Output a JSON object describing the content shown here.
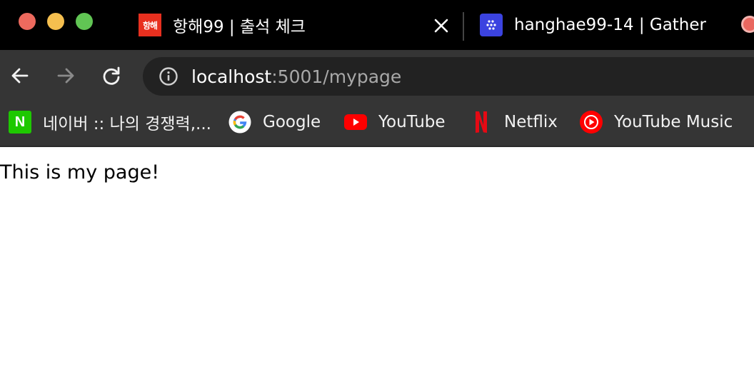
{
  "window": {
    "controls": {
      "close_color": "#ed6a5e",
      "minimize_color": "#f5bf4f",
      "maximize_color": "#61c554"
    }
  },
  "tabs": [
    {
      "title": "항해99 | 출석 체크",
      "favicon_text": "항해",
      "favicon_color": "#e8301f",
      "active": true
    },
    {
      "title": "hanghae99-14 | Gather",
      "favicon_icon": "gather-logo-icon",
      "favicon_color": "#3b43e0",
      "active": false
    }
  ],
  "toolbar": {
    "url_host": "localhost",
    "url_rest": ":5001/mypage"
  },
  "bookmarks": [
    {
      "label": "네이버 :: 나의 경쟁력,...",
      "icon": "naver-icon",
      "icon_text": "N"
    },
    {
      "label": "Google",
      "icon": "google-icon"
    },
    {
      "label": "YouTube",
      "icon": "youtube-icon"
    },
    {
      "label": "Netflix",
      "icon": "netflix-icon"
    },
    {
      "label": "YouTube Music",
      "icon": "youtube-music-icon"
    }
  ],
  "page": {
    "text": "This is my page!"
  }
}
